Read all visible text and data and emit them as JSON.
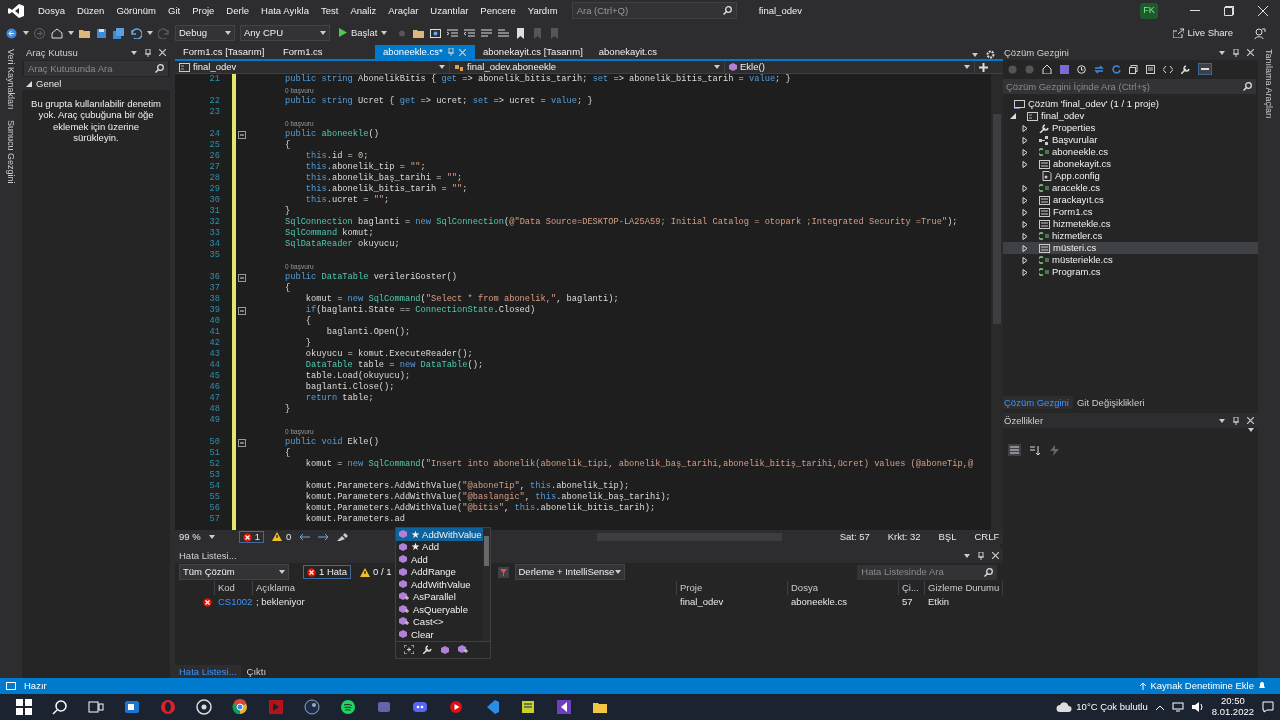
{
  "title_bar": {
    "menu": [
      "Dosya",
      "Düzen",
      "Görünüm",
      "Git",
      "Proje",
      "Derle",
      "Hata Ayıkla",
      "Test",
      "Analiz",
      "Araçlar",
      "Uzantılar",
      "Pencere",
      "Yardım"
    ],
    "search": {
      "placeholder": "Ara (Ctrl+Q)"
    },
    "solution_name": "final_odev",
    "user_initials": "FK"
  },
  "toolbar": {
    "configuration": "Debug",
    "platform": "Any CPU",
    "start_label": "Başlat",
    "live_share": "Live Share"
  },
  "side_tabs_left": [
    "Veri Kaynakları",
    "Sunucu Gezgini"
  ],
  "toolbox": {
    "title": "Araç Kutusu",
    "search": {
      "placeholder": "Araç Kutusunda Ara"
    },
    "group": {
      "label": "Genel",
      "expanded": true
    },
    "empty_message": "Bu grupta kullanılabilir denetim yok. Araç çubuğuna bir öğe eklemek için üzerine sürükleyin."
  },
  "editor": {
    "tabs": [
      {
        "label": "Form1.cs [Tasarım]",
        "selected": false
      },
      {
        "label": "Form1.cs",
        "selected": false
      },
      {
        "label": "aboneekle.cs*",
        "selected": true
      },
      {
        "label": "abonekayit.cs [Tasarım]",
        "selected": false
      },
      {
        "label": "abonekayit.cs",
        "selected": false
      }
    ],
    "nav": {
      "project": "final_odev",
      "class": "final_odev.aboneekle",
      "member": "Ekle()"
    },
    "lines": [
      {
        "number": "21",
        "code": [
          {
            "kind": "keyword",
            "text": "public string "
          },
          {
            "kind": "plain",
            "text": "AbonelikBitis { "
          },
          {
            "kind": "keyword",
            "text": "get"
          },
          {
            "kind": "plain",
            "text": " => abonelik_bitis_tarih; "
          },
          {
            "kind": "keyword",
            "text": "set"
          },
          {
            "kind": "plain",
            "text": " => abonelik_bitis_tarih = "
          },
          {
            "kind": "keyword",
            "text": "value"
          },
          {
            "kind": "plain",
            "text": "; }"
          }
        ]
      },
      {
        "lens": "0 başvuru"
      },
      {
        "number": "22",
        "code": [
          {
            "kind": "keyword",
            "text": "public string "
          },
          {
            "kind": "plain",
            "text": "Ucret { "
          },
          {
            "kind": "keyword",
            "text": "get"
          },
          {
            "kind": "plain",
            "text": " => ucret; "
          },
          {
            "kind": "keyword",
            "text": "set"
          },
          {
            "kind": "plain",
            "text": " => ucret = "
          },
          {
            "kind": "keyword",
            "text": "value"
          },
          {
            "kind": "plain",
            "text": "; }"
          }
        ]
      },
      {
        "number": "23"
      },
      {
        "lens": "0 başvuru"
      },
      {
        "number": "24",
        "folded": false,
        "code": [
          {
            "kind": "keyword",
            "text": "public "
          },
          {
            "kind": "type",
            "text": "aboneekle"
          },
          {
            "kind": "plain",
            "text": "()"
          }
        ]
      },
      {
        "number": "25",
        "code": [
          {
            "kind": "plain",
            "text": "{"
          }
        ]
      },
      {
        "number": "26",
        "code": [
          {
            "kind": "keyword",
            "text": "    this"
          },
          {
            "kind": "plain",
            "text": ".id = "
          },
          {
            "kind": "number",
            "text": "0"
          },
          {
            "kind": "plain",
            "text": ";"
          }
        ]
      },
      {
        "number": "27",
        "code": [
          {
            "kind": "keyword",
            "text": "    this"
          },
          {
            "kind": "plain",
            "text": ".abonelik_tip = "
          },
          {
            "kind": "string",
            "text": "\"\""
          },
          {
            "kind": "plain",
            "text": ";"
          }
        ]
      },
      {
        "number": "28",
        "code": [
          {
            "kind": "keyword",
            "text": "    this"
          },
          {
            "kind": "plain",
            "text": ".abonelik_baş_tarihi = "
          },
          {
            "kind": "string",
            "text": "\"\""
          },
          {
            "kind": "plain",
            "text": ";"
          }
        ]
      },
      {
        "number": "29",
        "code": [
          {
            "kind": "keyword",
            "text": "    this"
          },
          {
            "kind": "plain",
            "text": ".abonelik_bitis_tarih = "
          },
          {
            "kind": "string",
            "text": "\"\""
          },
          {
            "kind": "plain",
            "text": ";"
          }
        ]
      },
      {
        "number": "30",
        "code": [
          {
            "kind": "keyword",
            "text": "    this"
          },
          {
            "kind": "plain",
            "text": ".ucret = "
          },
          {
            "kind": "string",
            "text": "\"\""
          },
          {
            "kind": "plain",
            "text": ";"
          }
        ]
      },
      {
        "number": "31",
        "code": [
          {
            "kind": "plain",
            "text": "}"
          }
        ]
      },
      {
        "number": "32",
        "code": [
          {
            "kind": "type",
            "text": "SqlConnection"
          },
          {
            "kind": "plain",
            "text": " baglanti = "
          },
          {
            "kind": "keyword",
            "text": "new "
          },
          {
            "kind": "type",
            "text": "SqlConnection"
          },
          {
            "kind": "plain",
            "text": "("
          },
          {
            "kind": "string",
            "text": "@\"Data Source=DESKTOP-LA25A59; Initial Catalog = otopark ;Integrated Security =True\""
          },
          {
            "kind": "plain",
            "text": ");"
          }
        ]
      },
      {
        "number": "33",
        "code": [
          {
            "kind": "type",
            "text": "SqlCommand"
          },
          {
            "kind": "plain",
            "text": " komut;"
          }
        ]
      },
      {
        "number": "34",
        "code": [
          {
            "kind": "type",
            "text": "SqlDataReader"
          },
          {
            "kind": "plain",
            "text": " okuyucu;"
          }
        ]
      },
      {
        "number": "35"
      },
      {
        "lens": "0 başvuru"
      },
      {
        "number": "36",
        "folded": false,
        "code": [
          {
            "kind": "keyword",
            "text": "public "
          },
          {
            "kind": "type",
            "text": "DataTable"
          },
          {
            "kind": "plain",
            "text": " verileriGoster()"
          }
        ]
      },
      {
        "number": "37",
        "code": [
          {
            "kind": "plain",
            "text": "{"
          }
        ]
      },
      {
        "number": "38",
        "code": [
          {
            "kind": "plain",
            "text": "    komut = "
          },
          {
            "kind": "keyword",
            "text": "new "
          },
          {
            "kind": "type",
            "text": "SqlCommand"
          },
          {
            "kind": "plain",
            "text": "("
          },
          {
            "kind": "string",
            "text": "\"Select * from abonelik,\""
          },
          {
            "kind": "plain",
            "text": ", baglanti);"
          }
        ]
      },
      {
        "number": "39",
        "folded": false,
        "code": [
          {
            "kind": "keyword",
            "text": "    if"
          },
          {
            "kind": "plain",
            "text": "(baglanti.State == "
          },
          {
            "kind": "type",
            "text": "ConnectionState"
          },
          {
            "kind": "plain",
            "text": ".Closed)"
          }
        ]
      },
      {
        "number": "40",
        "code": [
          {
            "kind": "plain",
            "text": "    {"
          }
        ]
      },
      {
        "number": "41",
        "code": [
          {
            "kind": "plain",
            "text": "        baglanti.Open();"
          }
        ]
      },
      {
        "number": "42",
        "code": [
          {
            "kind": "plain",
            "text": "    }"
          }
        ]
      },
      {
        "number": "43",
        "code": [
          {
            "kind": "plain",
            "text": "    okuyucu = komut.ExecuteReader();"
          }
        ]
      },
      {
        "number": "44",
        "code": [
          {
            "kind": "type",
            "text": "    DataTable"
          },
          {
            "kind": "plain",
            "text": " table = "
          },
          {
            "kind": "keyword",
            "text": "new "
          },
          {
            "kind": "type",
            "text": "DataTable"
          },
          {
            "kind": "plain",
            "text": "();"
          }
        ]
      },
      {
        "number": "45",
        "code": [
          {
            "kind": "plain",
            "text": "    table.Load(okuyucu);"
          }
        ]
      },
      {
        "number": "46",
        "code": [
          {
            "kind": "plain",
            "text": "    baglanti.Close();"
          }
        ]
      },
      {
        "number": "47",
        "code": [
          {
            "kind": "keyword",
            "text": "    return"
          },
          {
            "kind": "plain",
            "text": " table;"
          }
        ]
      },
      {
        "number": "48",
        "code": [
          {
            "kind": "plain",
            "text": "}"
          }
        ]
      },
      {
        "number": "49"
      },
      {
        "lens": "0 başvuru"
      },
      {
        "number": "50",
        "folded": false,
        "code": [
          {
            "kind": "keyword",
            "text": "public void "
          },
          {
            "kind": "plain",
            "text": "Ekle()"
          }
        ]
      },
      {
        "number": "51",
        "code": [
          {
            "kind": "plain",
            "text": "{"
          }
        ]
      },
      {
        "number": "52",
        "code": [
          {
            "kind": "plain",
            "text": "    komut = "
          },
          {
            "kind": "keyword",
            "text": "new "
          },
          {
            "kind": "type",
            "text": "SqlCommand"
          },
          {
            "kind": "plain",
            "text": "("
          },
          {
            "kind": "string",
            "text": "\"Insert into abonelik(abonelik_tipi, abonelik_baş_tarihi,abonelik_bitiş_tarihi,ücret) values (@aboneTip,@"
          }
        ]
      },
      {
        "number": "53"
      },
      {
        "number": "54",
        "code": [
          {
            "kind": "plain",
            "text": "    komut.Parameters.AddWithValue("
          },
          {
            "kind": "string",
            "text": "\"@aboneTip\""
          },
          {
            "kind": "plain",
            "text": ", "
          },
          {
            "kind": "keyword",
            "text": "this"
          },
          {
            "kind": "plain",
            "text": ".abonelik_tip);"
          }
        ]
      },
      {
        "number": "55",
        "code": [
          {
            "kind": "plain",
            "text": "    komut.Parameters.AddWithValue("
          },
          {
            "kind": "string",
            "text": "\"@baslangic\""
          },
          {
            "kind": "plain",
            "text": ", "
          },
          {
            "kind": "keyword",
            "text": "this"
          },
          {
            "kind": "plain",
            "text": ".abonelik_baş_tarihi);"
          }
        ]
      },
      {
        "number": "56",
        "code": [
          {
            "kind": "plain",
            "text": "    komut.Parameters.AddWithValue("
          },
          {
            "kind": "string",
            "text": "\"@bitis\""
          },
          {
            "kind": "plain",
            "text": ", "
          },
          {
            "kind": "keyword",
            "text": "this"
          },
          {
            "kind": "plain",
            "text": ".abonelik_bitis_tarih);"
          }
        ]
      },
      {
        "number": "57",
        "code": [
          {
            "kind": "plain",
            "text": "    komut.Parameters.ad"
          }
        ]
      }
    ],
    "zoom": "99 %",
    "errors": "1",
    "warnings": "0",
    "cursor": {
      "line": "Sat: 57",
      "column": "Krkt: 32",
      "mode": "BŞL",
      "line_ending": "CRLF"
    }
  },
  "completion": {
    "items": [
      {
        "label": "★ AddWithValue",
        "kind": "method",
        "selected": true
      },
      {
        "label": "★ Add",
        "kind": "method",
        "selected": false
      },
      {
        "label": "Add",
        "kind": "method",
        "selected": false
      },
      {
        "label": "AddRange",
        "kind": "method",
        "selected": false
      },
      {
        "label": "AddWithValue",
        "kind": "method",
        "selected": false
      },
      {
        "label": "AsParallel",
        "kind": "extension",
        "selected": false
      },
      {
        "label": "AsQueryable",
        "kind": "extension",
        "selected": false
      },
      {
        "label": "Cast<>",
        "kind": "extension",
        "selected": false
      },
      {
        "label": "Clear",
        "kind": "method",
        "selected": false
      }
    ]
  },
  "error_list": {
    "title": "Hata Listesi...",
    "scope": "Tüm Çözüm",
    "errors_button": "1 Hata",
    "warnings_button": "0 / 1",
    "source": "Derleme + IntelliSense",
    "search": {
      "placeholder": "Hata Listesinde Ara"
    },
    "columns": [
      "Kod",
      "Açıklama",
      "Proje",
      "Dosya",
      "Çi...",
      "Gizleme Durumu"
    ],
    "rows": [
      {
        "kind": "error",
        "code": "CS1002",
        "description": "; bekleniyor",
        "project": "final_odev",
        "file": "aboneekle.cs",
        "line": "57",
        "suppression": "Etkin"
      }
    ]
  },
  "bottom_tabs": [
    {
      "label": "Hata Listesi...",
      "selected": true
    },
    {
      "label": "Çıktı",
      "selected": false
    }
  ],
  "solution_explorer": {
    "title": "Çözüm Gezgini",
    "search": {
      "placeholder": "Çözüm Gezgini İçinde Ara (Ctrl+ş)"
    },
    "tree": [
      {
        "label": "Çözüm 'final_odev' (1 / 1 proje)",
        "kind": "solution",
        "selected": false,
        "children": [
          {
            "label": "final_odev",
            "kind": "project",
            "expanded": true,
            "selected": false,
            "children": [
              {
                "label": "Properties",
                "kind": "properties",
                "expanded": false,
                "selected": false
              },
              {
                "label": "Başvurular",
                "kind": "references",
                "expanded": false,
                "selected": false
              },
              {
                "label": "aboneekle.cs",
                "kind": "cs",
                "expanded": false,
                "selected": false
              },
              {
                "label": "abonekayit.cs",
                "kind": "form",
                "expanded": false,
                "selected": false
              },
              {
                "label": "App.config",
                "kind": "config",
                "selected": false
              },
              {
                "label": "aracekle.cs",
                "kind": "cs",
                "expanded": false,
                "selected": false
              },
              {
                "label": "arackayıt.cs",
                "kind": "form",
                "expanded": false,
                "selected": false
              },
              {
                "label": "Form1.cs",
                "kind": "form",
                "expanded": false,
                "selected": false
              },
              {
                "label": "hizmetekle.cs",
                "kind": "form",
                "expanded": false,
                "selected": false
              },
              {
                "label": "hizmetler.cs",
                "kind": "cs",
                "expanded": false,
                "selected": false
              },
              {
                "label": "müsteri.cs",
                "kind": "form",
                "expanded": false,
                "selected": true
              },
              {
                "label": "müsteriekle.cs",
                "kind": "cs",
                "expanded": false,
                "selected": false
              },
              {
                "label": "Program.cs",
                "kind": "cs",
                "expanded": false,
                "selected": false
              }
            ]
          }
        ]
      }
    ],
    "tabs": [
      {
        "label": "Çözüm Gezgini",
        "selected": true
      },
      {
        "label": "Git Değişiklikleri",
        "selected": false
      }
    ]
  },
  "properties": {
    "title": "Özellikler"
  },
  "side_tabs_right": [
    "Tanılama Araçları"
  ],
  "status_bar": {
    "message": "Hazır",
    "source_control": "Kaynak Denetimine Ekle"
  },
  "taskbar": {
    "weather": "10°C Çok bulutlu",
    "time": "20:50",
    "date": "8.01.2022"
  }
}
